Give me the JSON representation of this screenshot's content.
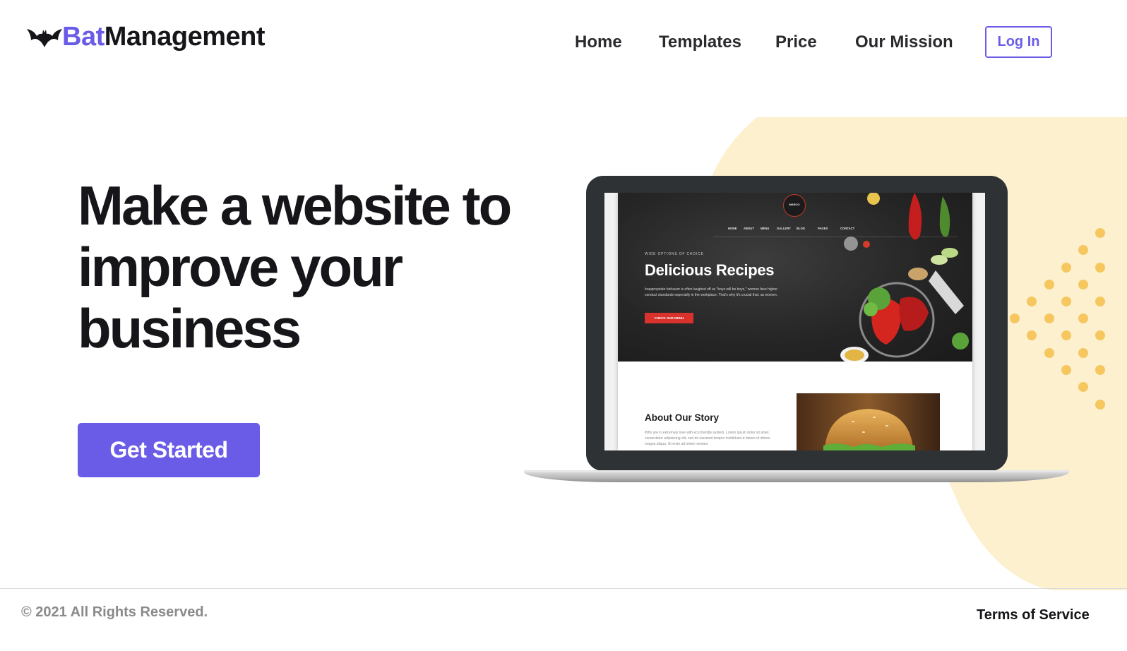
{
  "brand": {
    "name_part1": "Bat",
    "name_part2": "Management",
    "icon": "bat-icon",
    "accent_color": "#6b5ce7"
  },
  "nav": {
    "items": [
      {
        "label": "Home"
      },
      {
        "label": "Templates"
      },
      {
        "label": "Price"
      },
      {
        "label": "Our Mission"
      }
    ],
    "login_label": "Log In"
  },
  "hero": {
    "headline_lines": [
      "Make a website to",
      "improve your",
      "business"
    ],
    "cta_label": "Get Started"
  },
  "preview": {
    "logo_text": "MARCO",
    "nav_items": [
      "HOME",
      "ABOUT",
      "MENU",
      "GALLERY",
      "BLOG",
      "PAGES",
      "CONTACT"
    ],
    "eyebrow": "WIDE OPTIONS OF CHOICE",
    "title": "Delicious Recipes",
    "paragraph": "Inappropriate behavior is often laughed off as \"boys will be boys,\" women face higher conduct standards especially in the workplace. That's why it's crucial that, as women.",
    "button_label": "CHECK OUR MENU",
    "about_title": "About Our Story",
    "about_paragraph": "Who are in extremely love with eco friendly system. Lorem ipsum dolor sit amet, consectetur adipisicing elit, sed do eiusmod tempor incididunt ut labore et dolore magna aliqua. Ut enim ad minim veniam.",
    "accent_red": "#d9322c"
  },
  "footer": {
    "copyright": "© 2021 All Rights Reserved.",
    "terms_label": "Terms of Service"
  },
  "decor": {
    "blob_color": "#fdf0cf",
    "dot_color": "#f6c75e"
  }
}
